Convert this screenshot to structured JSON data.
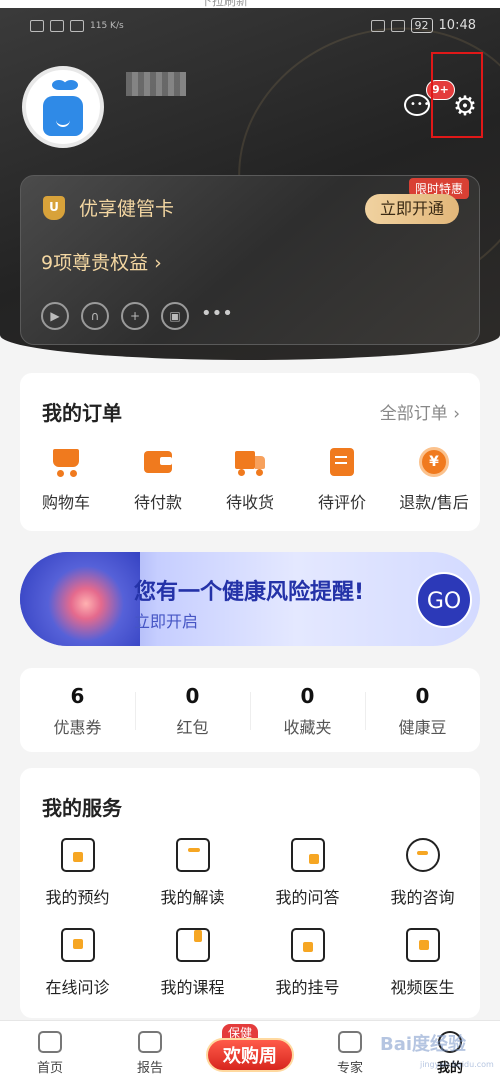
{
  "top_cut_text": "下拉刷新",
  "status_bar": {
    "speed": "115 K/s",
    "battery": "92",
    "time": "10:48"
  },
  "header": {
    "message_badge": "9+"
  },
  "vip_card": {
    "title": "优享健管卡",
    "ribbon": "限时特惠",
    "open_button": "立即开通",
    "benefits": "9项尊贵权益 ›",
    "more": "•••"
  },
  "orders": {
    "title": "我的订单",
    "all_link": "全部订单 ›",
    "items": [
      {
        "label": "购物车",
        "icon": "cart-icon"
      },
      {
        "label": "待付款",
        "icon": "wallet-icon"
      },
      {
        "label": "待收货",
        "icon": "truck-icon"
      },
      {
        "label": "待评价",
        "icon": "review-icon"
      },
      {
        "label": "退款/售后",
        "icon": "refund-icon"
      }
    ],
    "refund_symbol": "¥"
  },
  "banner": {
    "title": "您有一个健康风险提醒!",
    "subtitle": "立即开启",
    "go": "GO"
  },
  "stats": [
    {
      "value": "6",
      "label": "优惠券"
    },
    {
      "value": "0",
      "label": "红包"
    },
    {
      "value": "0",
      "label": "收藏夹"
    },
    {
      "value": "0",
      "label": "健康豆"
    }
  ],
  "services": {
    "title": "我的服务",
    "items": [
      {
        "label": "我的预约",
        "icon": "calendar-clock-icon"
      },
      {
        "label": "我的解读",
        "icon": "notebook-pen-icon"
      },
      {
        "label": "我的问答",
        "icon": "qa-document-icon"
      },
      {
        "label": "我的咨询",
        "icon": "chat-bubble-icon"
      },
      {
        "label": "在线问诊",
        "icon": "consult-chat-icon"
      },
      {
        "label": "我的课程",
        "icon": "course-book-icon"
      },
      {
        "label": "我的挂号",
        "icon": "calendar-plus-icon"
      },
      {
        "label": "视频医生",
        "icon": "video-doctor-icon"
      }
    ]
  },
  "tabbar": {
    "items": [
      {
        "label": "首页",
        "icon": "home-icon"
      },
      {
        "label": "报告",
        "icon": "report-icon"
      },
      {
        "label": "",
        "icon": ""
      },
      {
        "label": "专家",
        "icon": "expert-icon"
      },
      {
        "label": "我的",
        "icon": "profile-icon"
      }
    ],
    "promo_tag": "保健",
    "promo_main": "欢购周"
  },
  "watermark": {
    "brand": "Bai度经验",
    "url": "jingyan.baidu.com"
  },
  "colors": {
    "accent": "#f07a1e",
    "gold": "#f4d7a2",
    "badge_red": "#e43c3c",
    "banner_blue": "#2432a8"
  }
}
